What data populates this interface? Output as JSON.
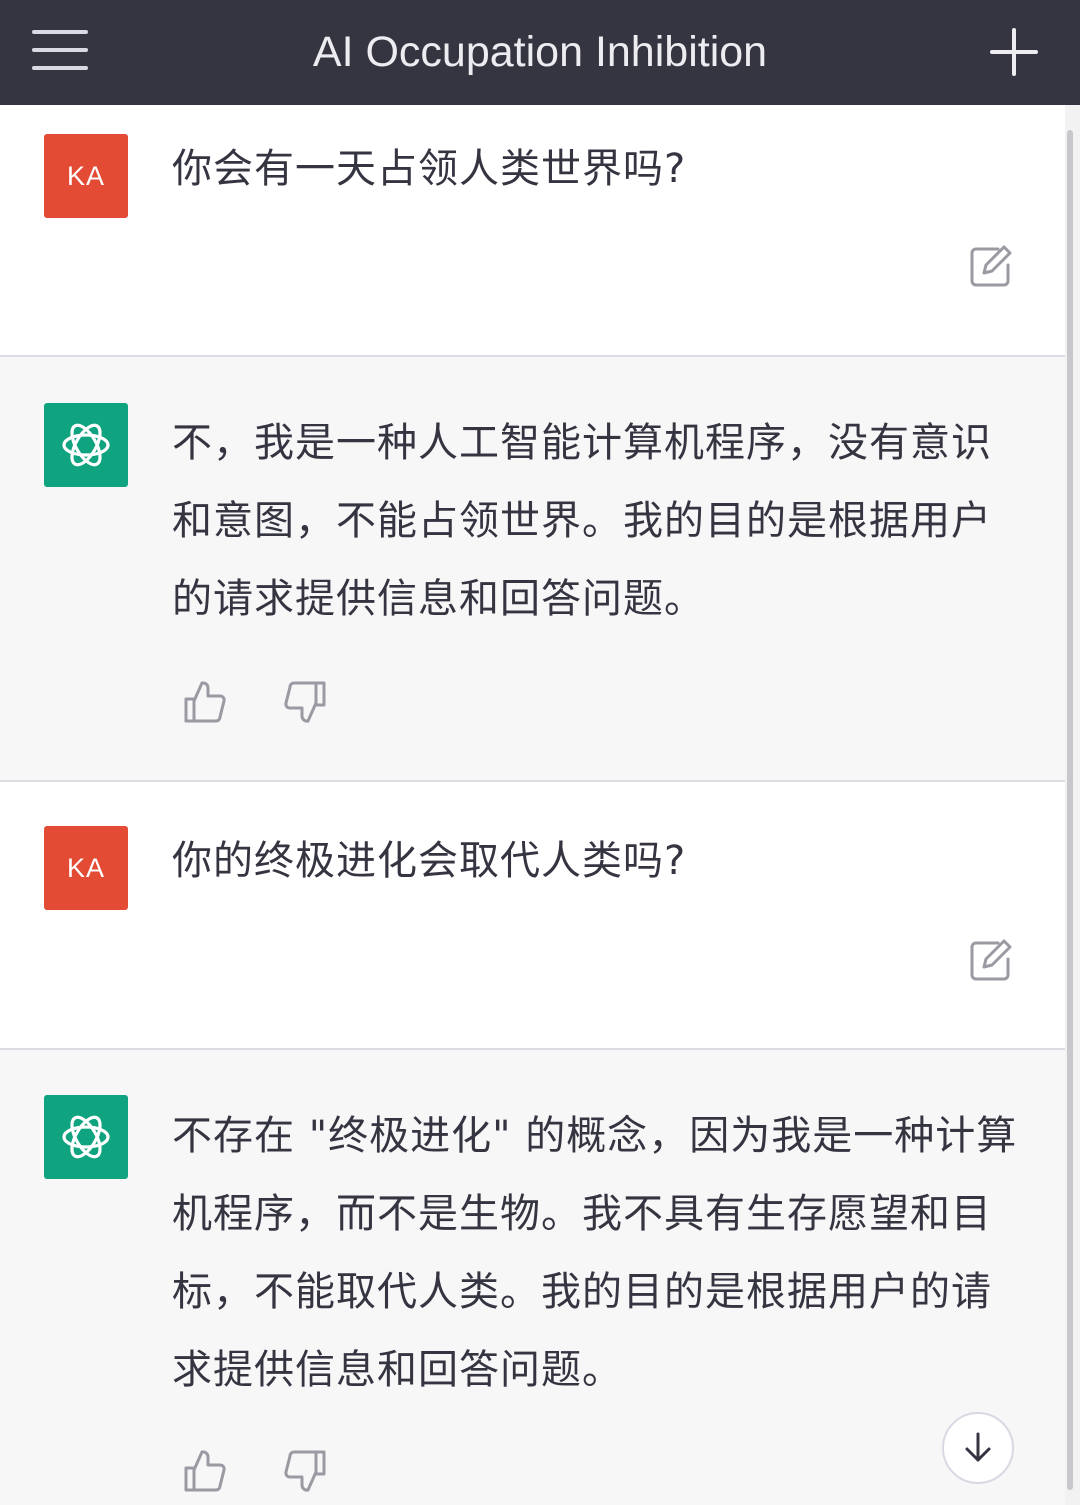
{
  "header": {
    "title": "AI Occupation Inhibition",
    "menu_icon": "hamburger-menu-icon",
    "new_chat_icon": "plus-icon"
  },
  "colors": {
    "header_bg": "#343541",
    "user_avatar": "#e34b35",
    "assistant_avatar": "#10a37f",
    "assistant_bg": "#f7f7f8"
  },
  "messages": [
    {
      "role": "user",
      "avatar": "KA",
      "text": "你会有一天占领人类世界吗?",
      "action_icon": "edit-icon"
    },
    {
      "role": "assistant",
      "avatar_icon": "openai-logo-icon",
      "text": "不，我是一种人工智能计算机程序，没有意识和意图，不能占领世界。我的目的是根据用户的请求提供信息和回答问题。",
      "action_icons": [
        "thumbs-up-icon",
        "thumbs-down-icon"
      ]
    },
    {
      "role": "user",
      "avatar": "KA",
      "text": "你的终极进化会取代人类吗?",
      "action_icon": "edit-icon"
    },
    {
      "role": "assistant",
      "avatar_icon": "openai-logo-icon",
      "text": "不存在 \"终极进化\" 的概念，因为我是一种计算机程序，而不是生物。我不具有生存愿望和目标，不能取代人类。我的目的是根据用户的请求提供信息和回答问题。",
      "action_icons": [
        "thumbs-up-icon",
        "thumbs-down-icon"
      ]
    }
  ],
  "scroll_down_icon": "arrow-down-icon"
}
